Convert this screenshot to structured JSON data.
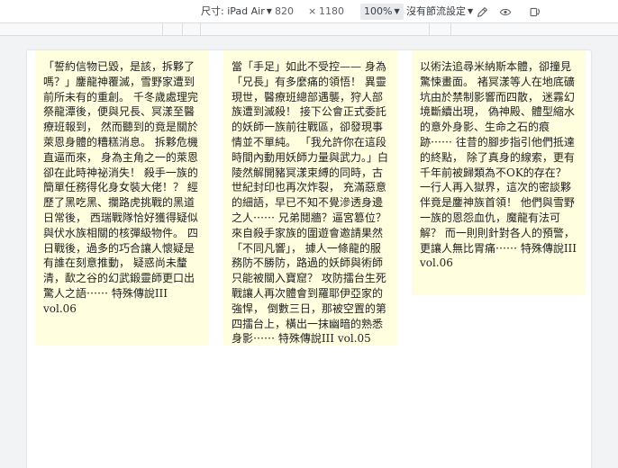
{
  "toolbar": {
    "dimensions_label": "尺寸: iPad Air",
    "width_value": "820",
    "times_symbol": "×",
    "height_value": "1180",
    "zoom_value": "100%",
    "throttling_label": "沒有節流設定",
    "icons": [
      "eyedropper-icon",
      "eye-icon",
      "rotate-icon"
    ]
  },
  "cards": [
    {
      "text": "「誓約信物已毀，是該，拆夥了嗎？」鏖龍神覆滅，雪野家遭到前所未有的重創。 千冬歲處理完祭龍潭後，便與兄長、冥漾至醫療班報到， 然而聽到的竟是關於萊恩身體的糟糕消息。 拆夥危機直逼而來， 身為主角之一的萊恩卻在此時神祕消失！ 殺手一族的簡單任務得化身女裝大佬！？ 經歷了黑吃黑、攔路虎挑戰的黑道日常後， 西瑞戰隊恰好獲得疑似與伏水族相關的核彈級物件。 四日戰後，過多的巧合讓人懷疑是有誰在刻意推動， 疑惑尚未釐清，歃之谷的幻武鍛靈師更口出驚人之語⋯⋯ 特殊傳說III vol.06"
    },
    {
      "text": "當「手足」如此不受控—— 身為「兄長」有多麼痛的領悟！ 異靈現世，醫療班總部遇襲，狩人部族遭到滅殺！ 接下公會正式委託的妖師一族前往戰區，卻發現事情並不單純。 「我允許你在這段時間內動用妖師力量與武力。」白陵然解開豬冥漾束縛的同時，古世紀封印也再次炸裂， 充滿惡意的細語，早已不知不覺滲透身邊之人⋯⋯ 兄弟鬩牆？逼宮篡位？來自殺手家族的圍遊會邀請果然「不同凡響」， 據人一條龍的服務防不勝防，路過的妖師與術師只能被關入寶窟？ 攻防擂台生死戰讓人再次體會到羅耶伊亞家的強悍， 倒數三日，那被空置的第四擂台上，橫出一抹幽暗的熟悉身影⋯⋯ 特殊傳說III vol.05"
    },
    {
      "text": "以術法追尋米納斯本體，卻撞見驚悚畫面。 褚冥漾等人在地底礦坑由於禁制影響而四散， 迷霧幻境斷續出現， 偽神殿、體型縮水的意外身影、生命之石的痕跡⋯⋯ 往昔的腳步指引他們抵達的終點， 除了真身的線索，更有千年前被歸類為不OK的存在？ 一行人再入獄界，這次的密談夥伴竟是鏖神族首領！ 他們與雪野一族的恩怨血仇，魔龍有法可解？ 而一則則針對各人的預警，更讓人無比胃痛⋯⋯ 特殊傳說III vol.06"
    }
  ]
}
